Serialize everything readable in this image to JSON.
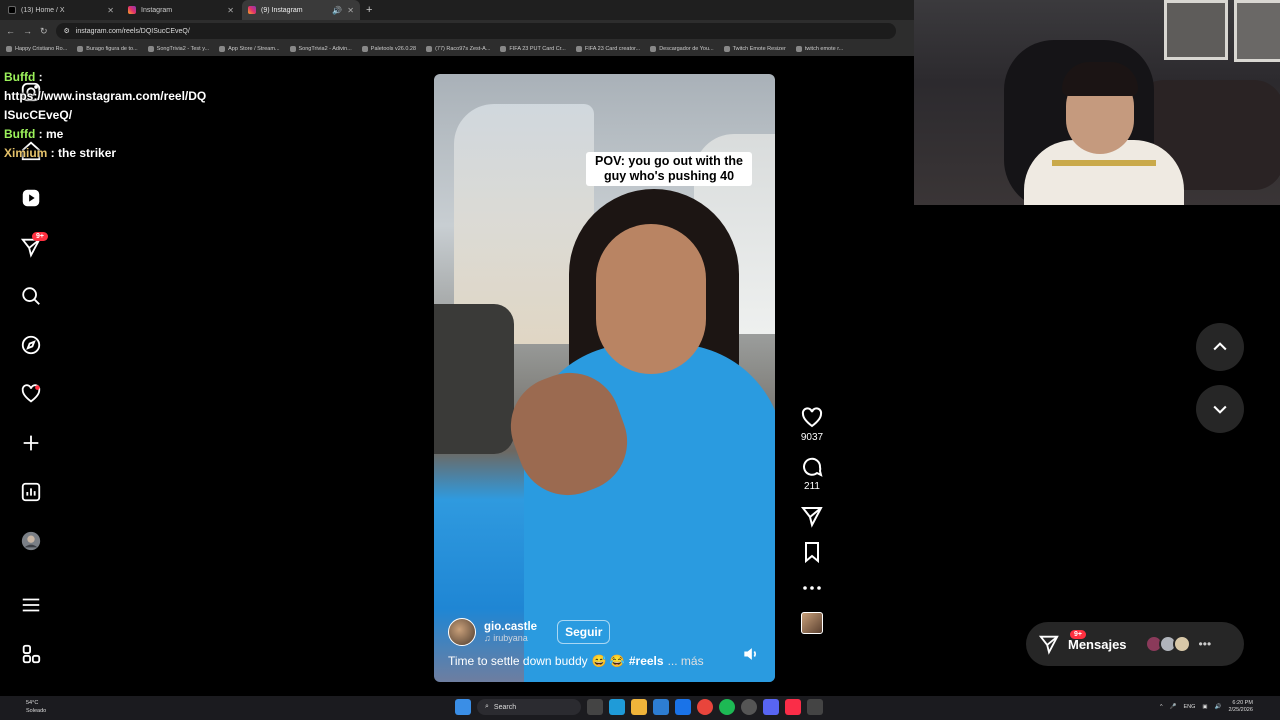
{
  "browser": {
    "tabs": [
      {
        "label": "(13) Home / X",
        "active": false
      },
      {
        "label": "Instagram",
        "active": false
      },
      {
        "label": "(9) Instagram",
        "active": true
      }
    ],
    "new_tab": "+",
    "url": "instagram.com/reels/DQISucCEveQ/",
    "bookmarks": [
      "Happy Cristiano Ro...",
      "Burago figura de to...",
      "SongTrivia2 - Test y...",
      "App Store / Stream...",
      "SongTrivia2 - Adivin...",
      "Paletools v26.0.28",
      "(77) Raco97s Zest-A...",
      "FIFA 23 PUT Card Cr...",
      "FIFA 23 Card creator...",
      "Descargador de You...",
      "Twitch Emote Resizer",
      "twitch emote r..."
    ]
  },
  "chat": [
    {
      "user": "Buffd",
      "sep": " :",
      "text": ""
    },
    {
      "user": "",
      "sep": "",
      "text": "https://www.instagram.com/reel/DQ"
    },
    {
      "user": "",
      "sep": "",
      "text": "ISucCEveQ/"
    },
    {
      "user": "Buffd",
      "sep": " : ",
      "text": "me"
    },
    {
      "user": "Ximium",
      "sep": " : ",
      "text": "the striker"
    }
  ],
  "nav": {
    "notification_badge": "9+"
  },
  "reel": {
    "overlay_text": "POV: you go out with the guy who's pushing 40",
    "author": "gio.castle",
    "audio_credit": "irubyana",
    "follow_label": "Seguir",
    "caption_text": "Time to settle down buddy",
    "caption_emoji": "😅 😂",
    "caption_tag": "#reels",
    "caption_more": "... más"
  },
  "actions": {
    "likes": "9037",
    "comments": "211"
  },
  "messages": {
    "label": "Mensajes",
    "badge": "9+"
  },
  "taskbar": {
    "temp": "54°C",
    "weather": "Soleado",
    "search": "Search",
    "lang": "ENG",
    "time": "6:20 PM",
    "date": "2/25/2026"
  },
  "colors": {
    "accent_badge": "#ff3040",
    "chat_user1": "#9cf25b",
    "chat_user2": "#e6c36a"
  }
}
